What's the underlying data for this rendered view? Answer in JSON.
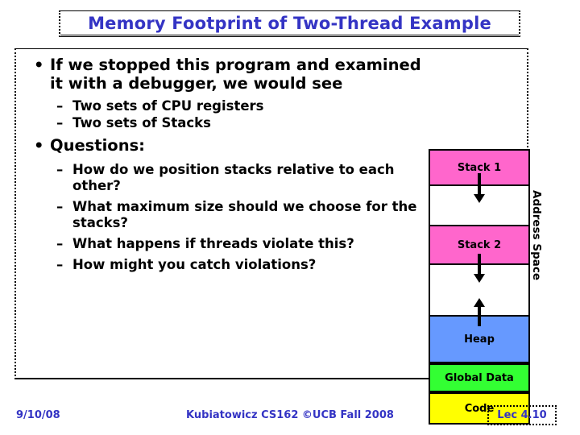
{
  "slide": {
    "title": "Memory Footprint of Two-Thread Example",
    "title_color": "#3434c4"
  },
  "bullets": [
    {
      "level": 1,
      "marker": "•",
      "text": "If we stopped this program and examined it with a debugger, we would see"
    },
    {
      "level": 2,
      "marker": "–",
      "text": "Two sets of CPU registers"
    },
    {
      "level": 2,
      "marker": "–",
      "text": "Two sets of Stacks"
    },
    {
      "level": 1,
      "marker": "•",
      "text": "Questions:"
    },
    {
      "level": 2,
      "marker": "–",
      "text": "How do we position stacks relative to each other?"
    },
    {
      "level": 2,
      "marker": "–",
      "text": "What maximum size should we choose for the stacks?"
    },
    {
      "level": 2,
      "marker": "–",
      "text": "What happens if threads violate this?"
    },
    {
      "level": 2,
      "marker": "–",
      "text": "How might you catch violations?"
    }
  ],
  "memory_diagram": {
    "address_space_label": "Address Space",
    "blocks": [
      {
        "label": "Stack 1",
        "color": "#ff66cc",
        "kind": "named"
      },
      {
        "label": "",
        "color": "#ffffff",
        "kind": "empty"
      },
      {
        "label": "Stack 2",
        "color": "#ff66cc",
        "kind": "named"
      },
      {
        "label": "",
        "color": "#ffffff",
        "kind": "empty"
      },
      {
        "label": "Heap",
        "color": "#6699ff",
        "kind": "named"
      },
      {
        "label": "Global Data",
        "color": "#33ff33",
        "kind": "named"
      },
      {
        "label": "Code",
        "color": "#ffff00",
        "kind": "named"
      }
    ],
    "arrows": [
      {
        "name": "stack1-grow-down",
        "direction": "down"
      },
      {
        "name": "stack2-grow-down",
        "direction": "down"
      },
      {
        "name": "heap-grow-up",
        "direction": "up"
      }
    ]
  },
  "footer": {
    "date": "9/10/08",
    "center": "Kubiatowicz CS162 ©UCB Fall 2008",
    "lecture": "Lec 4.10"
  }
}
